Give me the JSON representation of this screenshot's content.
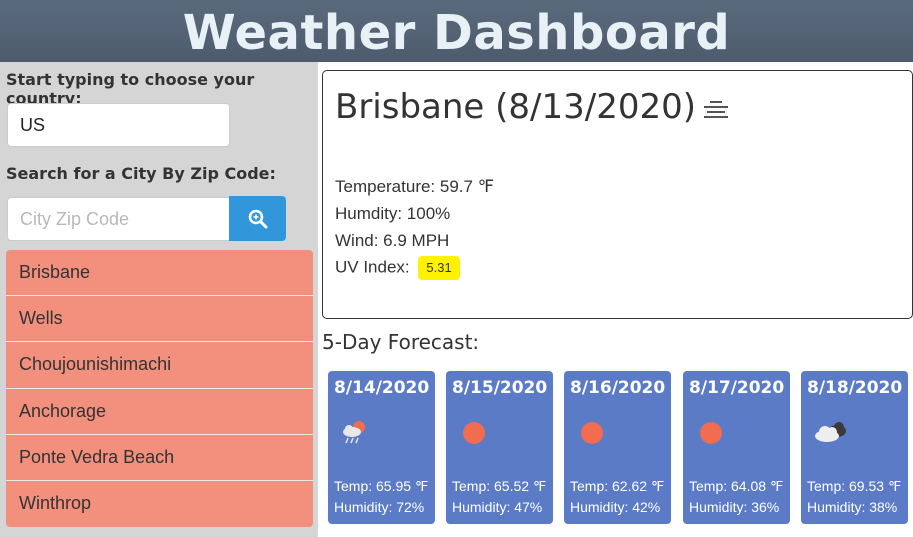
{
  "header": {
    "title": "Weather Dashboard"
  },
  "sidebar": {
    "country_label": "Start typing to choose your country:",
    "country_value": "US",
    "zip_label": "Search for a City By Zip Code:",
    "zip_placeholder": "City Zip Code",
    "search_icon": "search-icon",
    "cities": [
      "Brisbane",
      "Wells",
      "Choujounishimachi",
      "Anchorage",
      "Ponte Vedra Beach",
      "Winthrop"
    ]
  },
  "current": {
    "title": "Brisbane (8/13/2020)",
    "icon": "mist-icon",
    "temperature": "Temperature: 59.7 ℉",
    "humidity": "Humdity: 100%",
    "wind": "Wind: 6.9 MPH",
    "uv_label": "UV Index:",
    "uv_value": "5.31",
    "uv_color": "#fff200"
  },
  "forecast": {
    "title": "5-Day Forecast:",
    "days": [
      {
        "date": "8/14/2020",
        "icon": "rain-sun-icon",
        "temp": "Temp: 65.95 ℉",
        "humidity": "Humidity: 72%"
      },
      {
        "date": "8/15/2020",
        "icon": "sun-icon",
        "temp": "Temp: 65.52 ℉",
        "humidity": "Humidity: 47%"
      },
      {
        "date": "8/16/2020",
        "icon": "sun-icon",
        "temp": "Temp: 62.62 ℉",
        "humidity": "Humidity: 42%"
      },
      {
        "date": "8/17/2020",
        "icon": "sun-icon",
        "temp": "Temp: 64.08 ℉",
        "humidity": "Humidity: 36%"
      },
      {
        "date": "8/18/2020",
        "icon": "cloud-icon",
        "temp": "Temp: 69.53 ℉",
        "humidity": "Humidity: 38%"
      }
    ]
  },
  "colors": {
    "header": "#55657a",
    "sidebar": "#d5d5d5",
    "city_item": "#f28f7d",
    "search_button": "#3297da",
    "forecast_card": "#5b7bc7"
  }
}
